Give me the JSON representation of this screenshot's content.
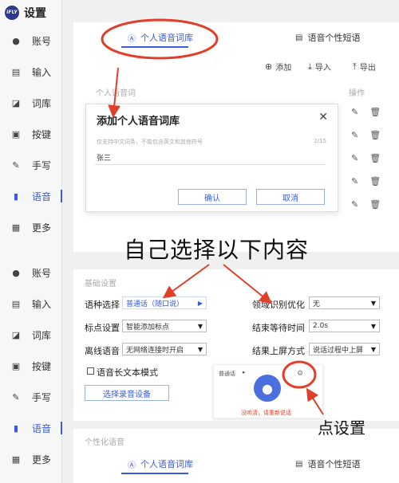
{
  "app": {
    "logo_text": "iFLY",
    "title": "设置"
  },
  "sidebar_top": [
    {
      "icon": "user-icon",
      "label": "账号"
    },
    {
      "icon": "keyboard-icon",
      "label": "输入"
    },
    {
      "icon": "dictionary-icon",
      "label": "词库"
    },
    {
      "icon": "key-icon",
      "label": "按键"
    },
    {
      "icon": "pen-icon",
      "label": "手写"
    },
    {
      "icon": "microphone-icon",
      "label": "语音",
      "active": true
    },
    {
      "icon": "grid-icon",
      "label": "更多"
    }
  ],
  "sidebar_bottom": [
    {
      "icon": "user-icon",
      "label": "账号"
    },
    {
      "icon": "keyboard-icon",
      "label": "输入"
    },
    {
      "icon": "dictionary-icon",
      "label": "词库"
    },
    {
      "icon": "key-icon",
      "label": "按键"
    },
    {
      "icon": "pen-icon",
      "label": "手写"
    },
    {
      "icon": "microphone-icon",
      "label": "语音",
      "active": true
    },
    {
      "icon": "grid-icon",
      "label": "更多"
    }
  ],
  "tabs": {
    "personal_lexicon": "个人语音词库",
    "personal_phrases": "语音个性短语"
  },
  "actions": {
    "add": "添加",
    "import": "导入",
    "export": "导出"
  },
  "table": {
    "column_word": "个人语音词",
    "column_ops": "操作",
    "row_count": 5
  },
  "dialog": {
    "title": "添加个人语音词库",
    "hint": "仅支持中文词条，不能包含英文和其他符号",
    "counter": "2/15",
    "input_value": "张三",
    "confirm": "确认",
    "cancel": "取消"
  },
  "annotations": {
    "caption_main": "自己选择以下内容",
    "caption_settings": "点设置"
  },
  "basic_settings": {
    "section_title": "基础设置",
    "language_label": "语种选择",
    "language_value": "普通话（随口说）",
    "punctuation_label": "标点设置",
    "punctuation_value": "智能添加标点",
    "offline_label": "离线语音",
    "offline_value": "无网络连接时开启",
    "domain_label": "领域识别优化",
    "domain_value": "无",
    "end_wait_label": "结束等待时间",
    "end_wait_value": "2.0s",
    "screen_mode_label": "结果上屏方式",
    "screen_mode_value": "说话过程中上屏",
    "long_text_label": "语音长文本模式",
    "record_device_button": "选择录音设备"
  },
  "voice_popup": {
    "lang": "普通话",
    "error": "没听清，请重新说话"
  },
  "personal_section": {
    "title": "个性化语音"
  },
  "colors": {
    "accent": "#3b5bdb",
    "annotation": "#e0402a"
  }
}
